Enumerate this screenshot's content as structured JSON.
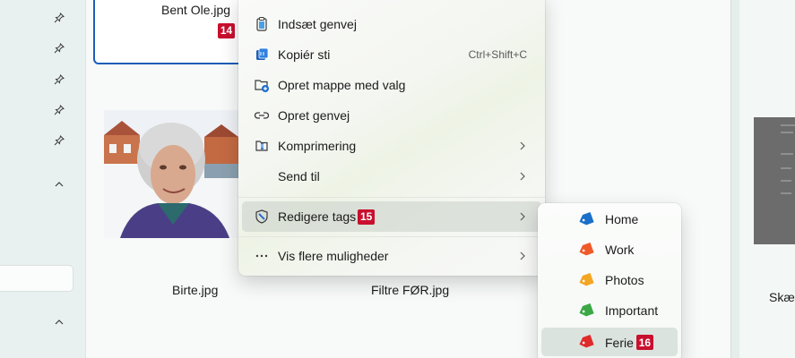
{
  "files": {
    "selected": {
      "name": "Bent Ole.jpg",
      "badge": "14"
    },
    "photo": {
      "name": "Birte.jpg"
    },
    "filter": {
      "name": "Filtre FØR.jpg"
    },
    "right": {
      "name": "Skæ"
    }
  },
  "context_menu": {
    "items": [
      {
        "label": "Indsæt genvej",
        "icon": "paste-shortcut-icon"
      },
      {
        "label": "Kopiér sti",
        "icon": "copy-path-icon",
        "shortcut": "Ctrl+Shift+C"
      },
      {
        "label": "Opret mappe med valg",
        "icon": "new-folder-icon"
      },
      {
        "label": "Opret genvej",
        "icon": "link-icon"
      },
      {
        "label": "Komprimering",
        "icon": "zip-icon"
      },
      {
        "label": "Send til",
        "icon": ""
      },
      {
        "label": "Redigere tags",
        "icon": "tag-shield-icon",
        "badge": "15"
      },
      {
        "label": "Vis flere muligheder",
        "icon": "more-icon"
      }
    ]
  },
  "tags_menu": {
    "items": [
      {
        "label": "Home",
        "color": "#1a6fc9"
      },
      {
        "label": "Work",
        "color": "#f05a28"
      },
      {
        "label": "Photos",
        "color": "#f4a623"
      },
      {
        "label": "Important",
        "color": "#3aa845"
      },
      {
        "label": "Ferie",
        "color": "#e02b2b",
        "badge": "16"
      }
    ]
  }
}
